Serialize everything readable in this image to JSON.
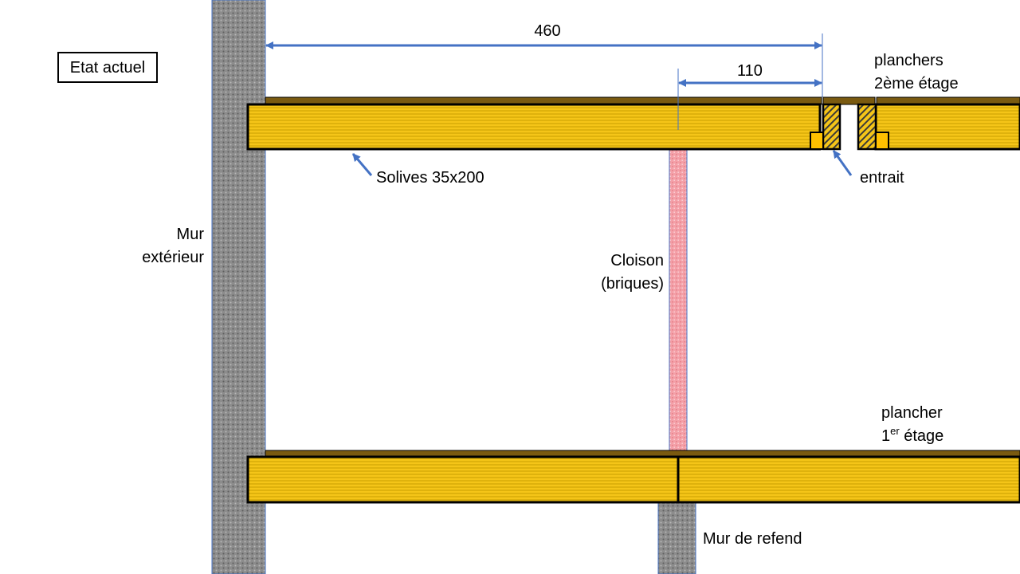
{
  "title": "Etat actuel",
  "dimensions": {
    "overall": "460",
    "partial": "110"
  },
  "labels": {
    "floors_upper_line1": "planchers",
    "floors_upper_line2": "2ème étage",
    "joists": "Solives 35x200",
    "tie_beam": "entrait",
    "exterior_wall_line1": "Mur",
    "exterior_wall_line2": "extérieur",
    "partition_line1": "Cloison",
    "partition_line2": "(briques)",
    "floor_lower_line1": "plancher",
    "floor_lower_line2_num": "1",
    "floor_lower_line2_sup": "er",
    "floor_lower_line2_rest": " étage",
    "bearing_wall": "Mur de refend"
  },
  "colors": {
    "wood": "#f5c518",
    "wood_stripe": "#c9a000",
    "floorboard": "#7a5a10",
    "wall": "#8a8a8a",
    "brick": "#f4a0a8",
    "dimension": "#4472c4",
    "block": "#ffc000"
  }
}
